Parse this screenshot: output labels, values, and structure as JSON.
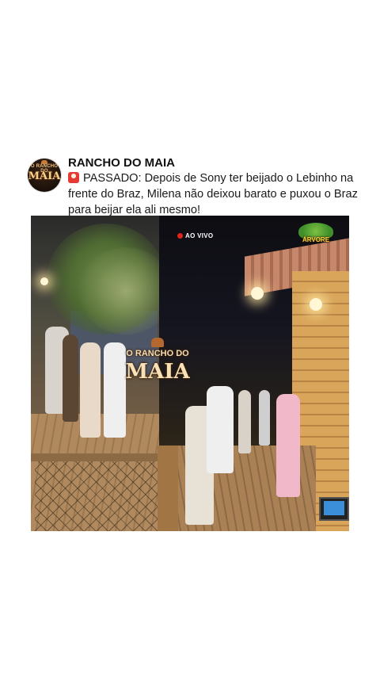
{
  "post": {
    "account_name": "RANCHO DO MAIA",
    "avatar": {
      "logo_top": "O RANCHO DO",
      "logo_main": "MAIA"
    },
    "caption_icon": "siren-emoji-icon",
    "caption": "PASSADO: Depois de Sony ter beijado o Lebinho na frente do Braz, Milena não deixou barato e puxou o Braz para beijar ela ali mesmo!"
  },
  "video": {
    "live_badge": "AO VIVO",
    "corner_logo": "ÁRVORE",
    "watermark_top": "O RANCHO DO",
    "watermark_main": "MAIA",
    "colors": {
      "live_dot": "#e0241a",
      "watermark_text": "#f7e2b7"
    }
  }
}
